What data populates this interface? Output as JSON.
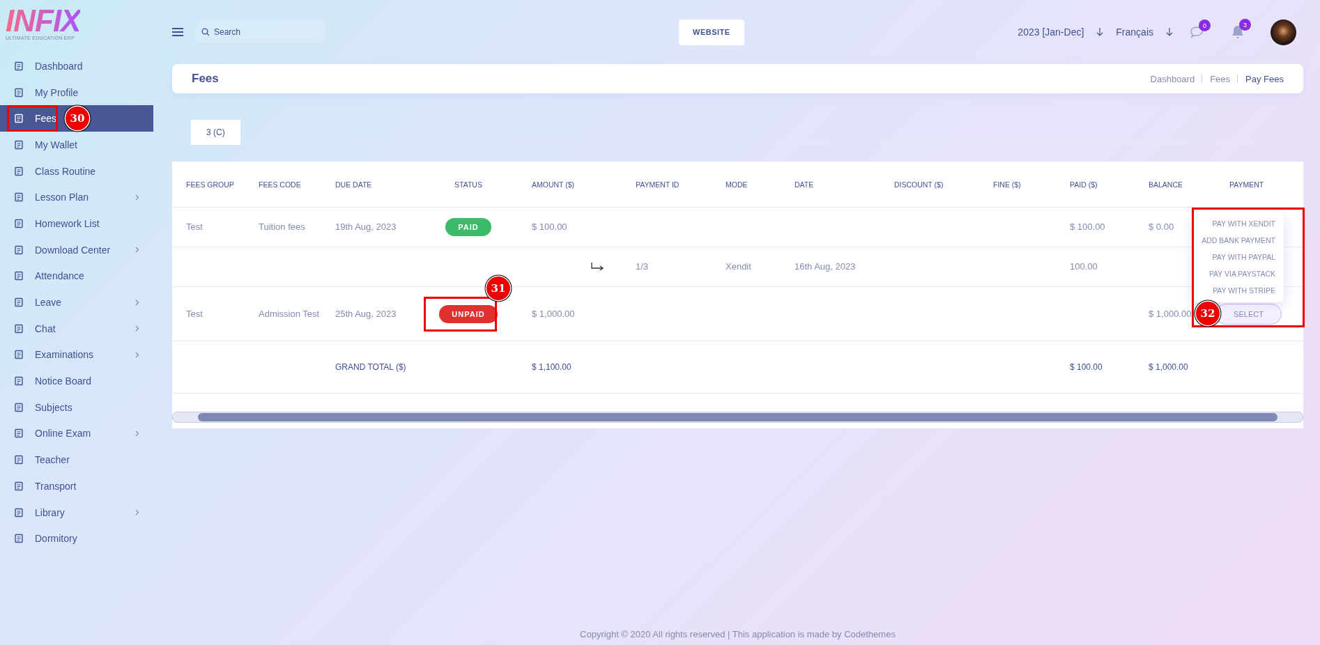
{
  "logo": {
    "name": "INFIX",
    "tagline": "ULTIMATE EDUCATION ERP"
  },
  "sidebar": {
    "items": [
      {
        "label": "Dashboard",
        "selected": false,
        "has_submenu": false
      },
      {
        "label": "My Profile",
        "selected": false,
        "has_submenu": false
      },
      {
        "label": "Fees",
        "selected": true,
        "has_submenu": false,
        "callout": "30"
      },
      {
        "label": "My Wallet",
        "selected": false,
        "has_submenu": false
      },
      {
        "label": "Class Routine",
        "selected": false,
        "has_submenu": false
      },
      {
        "label": "Lesson Plan",
        "selected": false,
        "has_submenu": true
      },
      {
        "label": "Homework List",
        "selected": false,
        "has_submenu": false
      },
      {
        "label": "Download Center",
        "selected": false,
        "has_submenu": true
      },
      {
        "label": "Attendance",
        "selected": false,
        "has_submenu": false
      },
      {
        "label": "Leave",
        "selected": false,
        "has_submenu": true
      },
      {
        "label": "Chat",
        "selected": false,
        "has_submenu": true
      },
      {
        "label": "Examinations",
        "selected": false,
        "has_submenu": true
      },
      {
        "label": "Notice Board",
        "selected": false,
        "has_submenu": false
      },
      {
        "label": "Subjects",
        "selected": false,
        "has_submenu": false
      },
      {
        "label": "Online Exam",
        "selected": false,
        "has_submenu": true
      },
      {
        "label": "Teacher",
        "selected": false,
        "has_submenu": false
      },
      {
        "label": "Transport",
        "selected": false,
        "has_submenu": false
      },
      {
        "label": "Library",
        "selected": false,
        "has_submenu": true
      },
      {
        "label": "Dormitory",
        "selected": false,
        "has_submenu": false
      }
    ]
  },
  "topbar": {
    "search": {
      "placeholder": "Search"
    },
    "website_button": "WEBSITE",
    "year": "2023 [Jan-Dec]",
    "language": "Français",
    "messages_count": "0",
    "notifications_count": "3"
  },
  "page_header": {
    "title": "Fees",
    "breadcrumb": [
      "Dashboard",
      "Fees",
      "Pay Fees"
    ]
  },
  "tabs": [
    {
      "label": "3 (C)",
      "selected": true
    }
  ],
  "table": {
    "columns": [
      "FEES GROUP",
      "FEES CODE",
      "DUE DATE",
      "STATUS",
      "AMOUNT ($)",
      "PAYMENT ID",
      "MODE",
      "DATE",
      "DISCOUNT ($)",
      "FINE ($)",
      "PAID ($)",
      "BALANCE",
      "PAYMENT"
    ],
    "rows": [
      {
        "kind": "fee",
        "fees_group": "Test",
        "fees_code": "Tuition fees",
        "due_date": "19th Aug, 2023",
        "status": {
          "label": "PAID",
          "kind": "paid"
        },
        "amount": "$ 100.00",
        "paid": "$ 100.00",
        "balance": "$ 0.00"
      },
      {
        "kind": "payment",
        "payment_id": "1/3",
        "mode": "Xendit",
        "date": "16th Aug, 2023",
        "paid": "100.00"
      },
      {
        "kind": "fee",
        "fees_group": "Test",
        "fees_code": "Admission Test",
        "due_date": "25th Aug, 2023",
        "status": {
          "label": "UNPAID",
          "kind": "unpaid",
          "callout": "31"
        },
        "amount": "$ 1,000.00",
        "balance": "$ 1,000.00",
        "payment": {
          "button": "SELECT",
          "expanded": true,
          "callout": "32",
          "options": [
            "PAY WITH XENDIT",
            "ADD BANK PAYMENT",
            "PAY WITH PAYPAL",
            "PAY VIA PAYSTACK",
            "PAY WITH STRIPE"
          ]
        }
      },
      {
        "kind": "total",
        "label": "GRAND TOTAL ($)",
        "amount": "$ 1,100.00",
        "paid": "$ 100.00",
        "balance": "$ 1,000.00"
      }
    ]
  },
  "footer": "Copyright © 2020 All rights reserved | This application is made by Codethemes"
}
